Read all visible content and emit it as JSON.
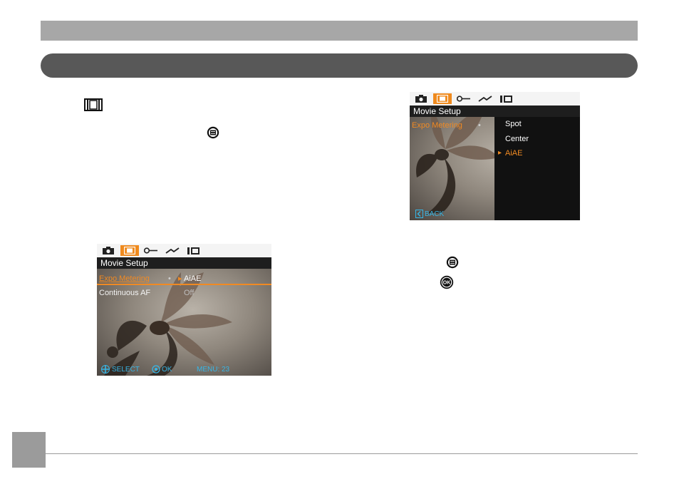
{
  "screen1": {
    "tabs": [
      "camera-tab",
      "movie-tab",
      "key-tab",
      "wrench-tab",
      "settings-tab"
    ],
    "active_tab": "movie-tab",
    "title": "Movie Setup",
    "rows": [
      {
        "label": "Expo Metering",
        "value": "AiAE",
        "selected": true
      },
      {
        "label": "Continuous AF",
        "value": "Off",
        "selected": false
      }
    ],
    "status": {
      "select": "SELECT",
      "ok": "OK",
      "menu": "MENU: 23"
    }
  },
  "screen2": {
    "tabs": [
      "camera-tab",
      "movie-tab",
      "key-tab",
      "wrench-tab",
      "settings-tab"
    ],
    "active_tab": "movie-tab",
    "title": "Movie Setup",
    "setting_label": "Expo Metering",
    "options": [
      "Spot",
      "Center",
      "AiAE"
    ],
    "selected_option": "AiAE",
    "back": "BACK"
  },
  "colors": {
    "accent": "#ef8a1e",
    "status_text": "#37b6e6",
    "top_band": "#a7a7a7",
    "section_bar": "#585858",
    "page_box": "#9b9b9b"
  },
  "icons": [
    "film-icon",
    "menu-button-icon",
    "ok-button-icon"
  ]
}
